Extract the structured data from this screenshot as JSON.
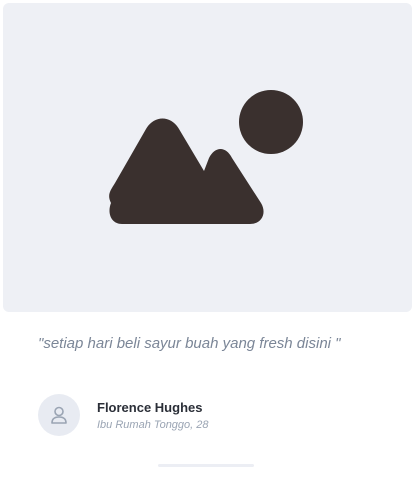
{
  "testimonial": {
    "image_icon": "image-placeholder-icon",
    "quote": "\"setiap hari beli sayur buah yang fresh disini \"",
    "author": {
      "avatar_icon": "user-icon",
      "name": "Florence Hughes",
      "role": "Ibu Rumah Tonggo, 28"
    }
  },
  "colors": {
    "image_background": "#eef0f5",
    "icon_fill": "#3a302e",
    "quote_text": "#7b8697",
    "name_text": "#2b2f38",
    "role_text": "#9aa4b3",
    "avatar_background": "#e8ebf2"
  }
}
